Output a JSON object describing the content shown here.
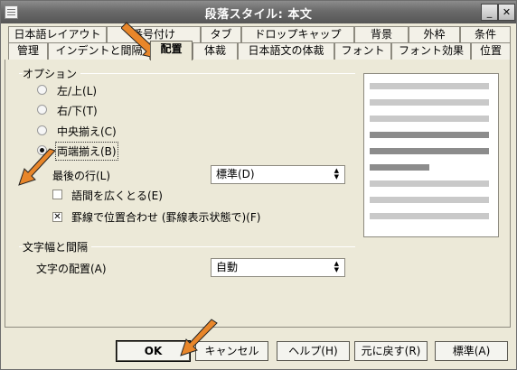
{
  "window": {
    "title": "段落スタイル: 本文"
  },
  "tabs": {
    "back_row": [
      "日本語レイアウト",
      "番号付け",
      "タブ",
      "ドロップキャップ",
      "背景",
      "外枠",
      "条件"
    ],
    "front_row": [
      "管理",
      "インデントと間隔",
      "配置",
      "体裁",
      "日本語文の体裁",
      "フォント",
      "フォント効果",
      "位置"
    ],
    "active": "配置"
  },
  "options": {
    "heading": "オプション",
    "radios": [
      {
        "label": "左/上(L)",
        "checked": false
      },
      {
        "label": "右/下(T)",
        "checked": false
      },
      {
        "label": "中央揃え(C)",
        "checked": false
      },
      {
        "label": "両端揃え(B)",
        "checked": true
      }
    ],
    "last_line_label": "最後の行(L)",
    "last_line_value": "標準(D)",
    "word_spacing_label": "語間を広くとる(E)",
    "word_spacing_checked": false,
    "snap_label": "罫線で位置合わせ (罫線表示状態で)(F)",
    "snap_checked": true
  },
  "char_spacing": {
    "heading": "文字幅と間隔",
    "alignment_label": "文字の配置(A)",
    "alignment_value": "自動"
  },
  "buttons": {
    "ok": "OK",
    "cancel": "キャンセル",
    "help": "ヘルプ(H)",
    "reset": "元に戻す(R)",
    "standard": "標準(A)"
  },
  "icons": {
    "minimize": "minimize-icon",
    "close": "close-icon",
    "pointer": "orange-arrow-icon"
  },
  "colors": {
    "window_bg": "#ece9d8",
    "titlebar": "#6a6a6a",
    "arrow": "#e8862a",
    "preview_light": "#c9c9c9",
    "preview_dark": "#8c8c8c"
  }
}
